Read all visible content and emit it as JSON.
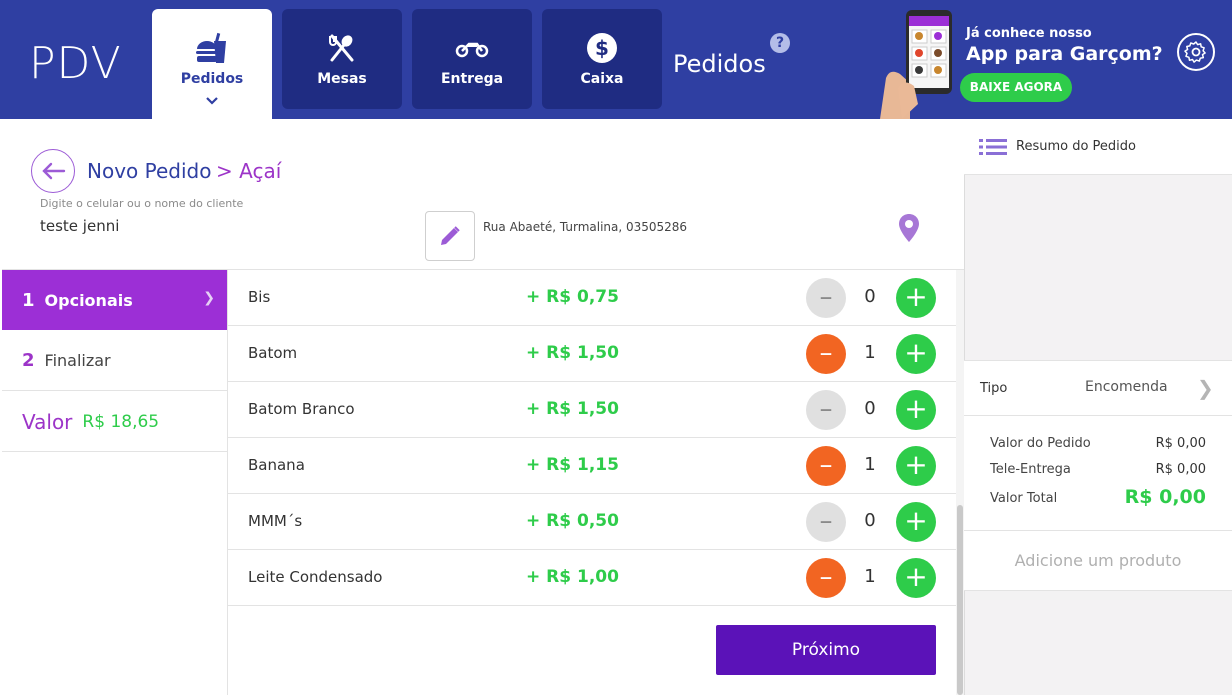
{
  "header": {
    "logo": "PDV",
    "section_title": "Pedidos",
    "help": "?",
    "tabs": [
      {
        "label": "Pedidos",
        "icon": "burger-drink-icon",
        "active": true
      },
      {
        "label": "Mesas",
        "icon": "fork-spoon-icon",
        "active": false
      },
      {
        "label": "Entrega",
        "icon": "motorcycle-icon",
        "active": false
      },
      {
        "label": "Caixa",
        "icon": "dollar-circle-icon",
        "active": false
      }
    ],
    "promo": {
      "line1": "Já conhece nosso",
      "line2": "App para Garçom?",
      "button": "BAIXE AGORA"
    }
  },
  "order": {
    "breadcrumb_main": "Novo Pedido",
    "breadcrumb_sub": "> Açaí",
    "client_label": "Digite o celular ou o nome do cliente",
    "client_value": "teste jenni",
    "address": "Rua Abaeté, Turmalina, 03505286"
  },
  "steps": {
    "step1_num": "1",
    "step1_label": "Opcionais",
    "step2_num": "2",
    "step2_label": "Finalizar",
    "valor_label": "Valor",
    "valor_value": "R$ 18,65"
  },
  "items": [
    {
      "name": "Bis",
      "price": "+ R$ 0,75",
      "qty": "0"
    },
    {
      "name": "Batom",
      "price": "+ R$ 1,50",
      "qty": "1"
    },
    {
      "name": "Batom Branco",
      "price": "+ R$ 1,50",
      "qty": "0"
    },
    {
      "name": "Banana",
      "price": "+ R$ 1,15",
      "qty": "1"
    },
    {
      "name": "MMM´s",
      "price": "+ R$ 0,50",
      "qty": "0"
    },
    {
      "name": "Leite Condensado",
      "price": "+ R$ 1,00",
      "qty": "1"
    }
  ],
  "next_button": "Próximo",
  "summary": {
    "title": "Resumo do Pedido",
    "tipo_label": "Tipo",
    "tipo_value": "Encomenda",
    "valor_pedido_label": "Valor do Pedido",
    "valor_pedido": "R$ 0,00",
    "tele_entrega_label": "Tele-Entrega",
    "tele_entrega": "R$ 0,00",
    "valor_total_label": "Valor Total",
    "valor_total": "R$ 0,00",
    "add_product": "Adicione um produto"
  },
  "colors": {
    "header_bg": "#2f3fa2",
    "tab_bg": "#1f2c82",
    "purple": "#9c2fd6",
    "green": "#2ecc4a",
    "orange": "#f26522",
    "next_button_bg": "#5b12b8"
  }
}
